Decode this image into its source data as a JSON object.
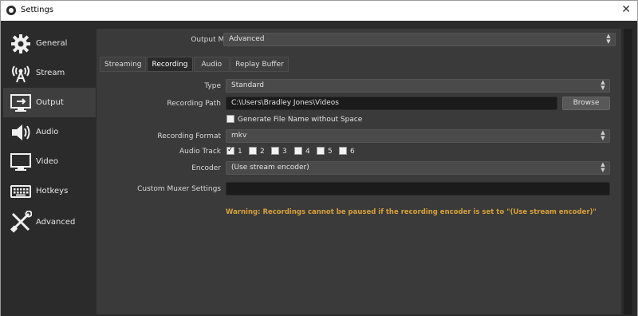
{
  "window": {
    "title": "Settings"
  },
  "sidebar": {
    "items": [
      {
        "label": "General",
        "icon": "gear-icon"
      },
      {
        "label": "Stream",
        "icon": "antenna-icon"
      },
      {
        "label": "Output",
        "icon": "monitor-output-icon",
        "active": true
      },
      {
        "label": "Audio",
        "icon": "speaker-icon"
      },
      {
        "label": "Video",
        "icon": "monitor-icon"
      },
      {
        "label": "Hotkeys",
        "icon": "keyboard-icon"
      },
      {
        "label": "Advanced",
        "icon": "tools-icon"
      }
    ]
  },
  "output_mode": {
    "label": "Output Mode",
    "value": "Advanced"
  },
  "tabs": [
    {
      "label": "Streaming"
    },
    {
      "label": "Recording",
      "active": true
    },
    {
      "label": "Audio"
    },
    {
      "label": "Replay Buffer"
    }
  ],
  "recording": {
    "type": {
      "label": "Type",
      "value": "Standard"
    },
    "path": {
      "label": "Recording Path",
      "value": "C:\\Users\\Bradley Jones\\Videos",
      "browse": "Browse"
    },
    "no_space": {
      "label": "Generate File Name without Space",
      "checked": false
    },
    "format": {
      "label": "Recording Format",
      "value": "mkv"
    },
    "audio_track": {
      "label": "Audio Track",
      "tracks": [
        {
          "label": "1",
          "checked": true
        },
        {
          "label": "2",
          "checked": false
        },
        {
          "label": "3",
          "checked": false
        },
        {
          "label": "4",
          "checked": false
        },
        {
          "label": "5",
          "checked": false
        },
        {
          "label": "6",
          "checked": false
        }
      ]
    },
    "encoder": {
      "label": "Encoder",
      "value": "(Use stream encoder)"
    },
    "muxer": {
      "label": "Custom Muxer Settings",
      "value": ""
    },
    "warning": "Warning: Recordings cannot be paused if the recording encoder is set to \"(Use stream encoder)\""
  },
  "colors": {
    "warning": "#d6a13a",
    "panel": "#3a3a3a",
    "sidebar": "#2b2b2b"
  }
}
